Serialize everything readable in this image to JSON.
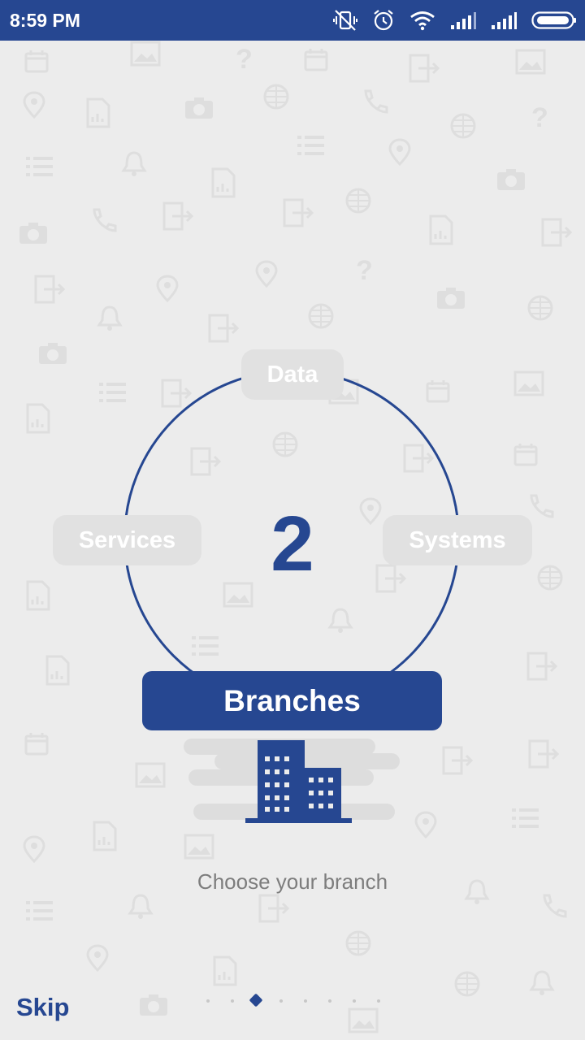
{
  "status_bar": {
    "time": "8:59 PM",
    "icons": [
      "vibrate-off-icon",
      "alarm-icon",
      "wifi-icon",
      "signal-icon",
      "signal-icon",
      "battery-icon"
    ]
  },
  "carousel": {
    "center_number": "2",
    "options": {
      "top": "Data",
      "left": "Services",
      "right": "Systems"
    },
    "selected_label": "Branches",
    "selected_icon": "building-icon",
    "subtitle": "Choose your branch",
    "page_count": 8,
    "current_page": 3
  },
  "footer": {
    "skip_label": "Skip"
  },
  "colors": {
    "brand": "#264791",
    "background": "#ececec",
    "pill": "#e1e1e1"
  }
}
